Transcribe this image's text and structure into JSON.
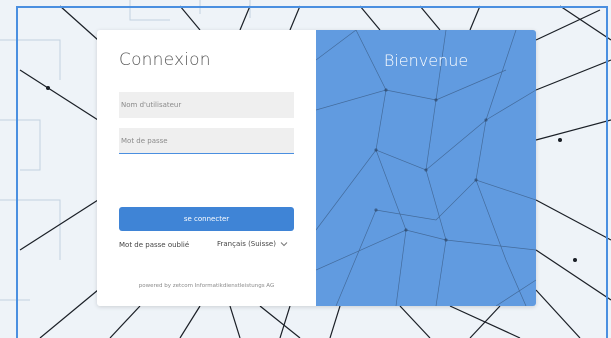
{
  "login": {
    "title": "Connexion",
    "username_placeholder": "Nom d'utilisateur",
    "password_placeholder": "Mot de passe",
    "submit_label": "se connecter",
    "forgot_password": "Mot de passe oublié",
    "language": "Français (Suisse)",
    "language_icon": "chevron-down-icon",
    "powered_by": "powered by zetcom Informatikdienstleistungs AG"
  },
  "welcome_panel": {
    "title": "Bienvenue"
  },
  "colors": {
    "accent": "#3f84d6",
    "frame": "#4a8fe0",
    "panel": "#498cdc"
  }
}
